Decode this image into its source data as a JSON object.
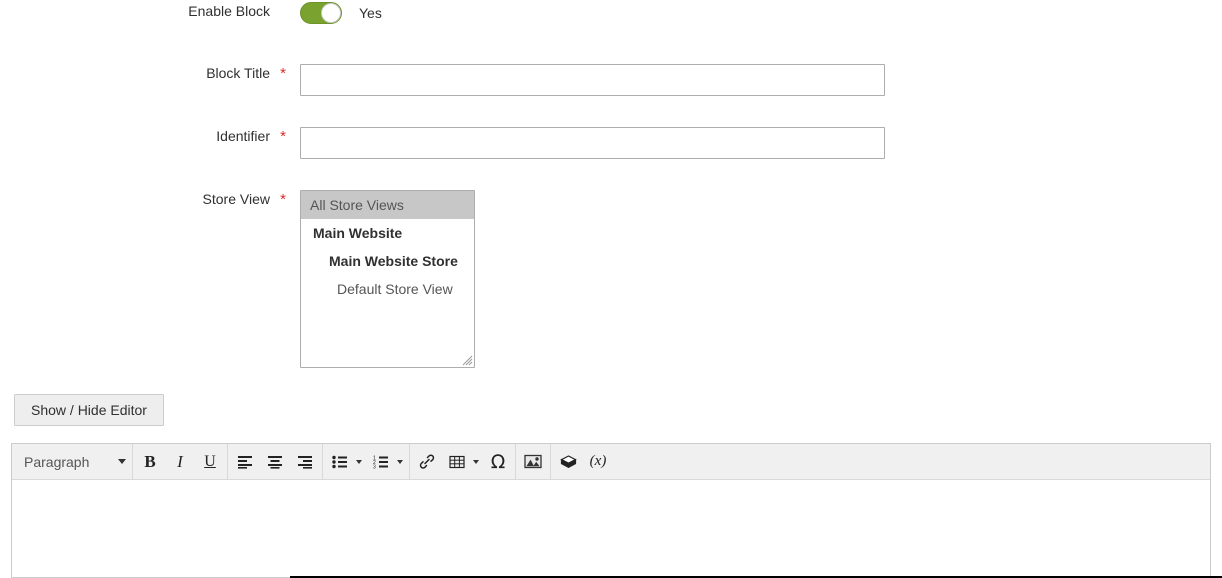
{
  "form": {
    "enable_block": {
      "label": "Enable Block",
      "toggle_state": "on",
      "toggle_text": "Yes",
      "toggle_color": "#79a22e"
    },
    "block_title": {
      "label": "Block Title",
      "required_marker": "*",
      "value": "",
      "placeholder": ""
    },
    "identifier": {
      "label": "Identifier",
      "required_marker": "*",
      "value": "",
      "placeholder": ""
    },
    "store_view": {
      "label": "Store View",
      "required_marker": "*",
      "options": [
        {
          "label": "All Store Views",
          "level": "all",
          "selected": true
        },
        {
          "label": "Main Website",
          "level": "website",
          "selected": false
        },
        {
          "label": "Main Website Store",
          "level": "store",
          "selected": false
        },
        {
          "label": "Default Store View",
          "level": "view",
          "selected": false
        }
      ]
    }
  },
  "editor": {
    "show_hide_button": "Show / Hide Editor",
    "toolbar": {
      "format_select": {
        "value": "Paragraph",
        "icon": "chevron-down-icon"
      },
      "buttons": [
        {
          "name": "bold-button",
          "icon": "bold-icon",
          "glyph": "B"
        },
        {
          "name": "italic-button",
          "icon": "italic-icon",
          "glyph": "I"
        },
        {
          "name": "underline-button",
          "icon": "underline-icon",
          "glyph": "U"
        },
        {
          "name": "align-left-button",
          "icon": "align-left-icon"
        },
        {
          "name": "align-center-button",
          "icon": "align-center-icon"
        },
        {
          "name": "align-right-button",
          "icon": "align-right-icon"
        },
        {
          "name": "bullet-list-button",
          "icon": "bullet-list-icon"
        },
        {
          "name": "numbered-list-button",
          "icon": "numbered-list-icon"
        },
        {
          "name": "insert-link-button",
          "icon": "link-icon"
        },
        {
          "name": "insert-table-button",
          "icon": "table-icon"
        },
        {
          "name": "special-character-button",
          "icon": "omega-icon",
          "glyph": "Ω"
        },
        {
          "name": "insert-image-button",
          "icon": "image-icon"
        },
        {
          "name": "insert-widget-button",
          "icon": "widget-icon"
        },
        {
          "name": "insert-variable-button",
          "icon": "variable-icon",
          "glyph": "(x)"
        }
      ]
    },
    "content": ""
  },
  "colors": {
    "required_asterisk": "#e02b27",
    "label_text": "#303030",
    "toggle_on": "#79a22e",
    "selected_option_bg": "#c7c7c7",
    "toolbar_bg": "#f0f0f0",
    "input_border": "#adadad"
  }
}
